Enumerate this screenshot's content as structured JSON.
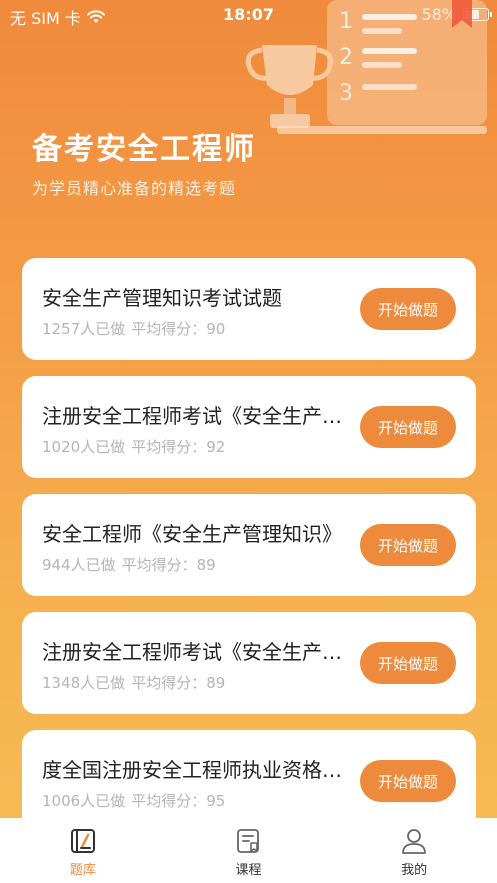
{
  "status_bar": {
    "carrier": "无 SIM 卡",
    "time": "18:07",
    "battery_text": "58%",
    "battery_level": 0.58
  },
  "hero": {
    "title": "备考安全工程师",
    "subtitle": "为学员精心准备的精选考题"
  },
  "exams": [
    {
      "title": "安全生产管理知识考试试题",
      "participants": "1257人已做",
      "avg_score": "平均得分：90",
      "button": "开始做题"
    },
    {
      "title": "注册安全工程师考试《安全生产管理知识》",
      "participants": "1020人已做",
      "avg_score": "平均得分：92",
      "button": "开始做题"
    },
    {
      "title": "安全工程师《安全生产管理知识》",
      "participants": "944人已做",
      "avg_score": "平均得分：89",
      "button": "开始做题"
    },
    {
      "title": "注册安全工程师考试《安全生产技术》",
      "participants": "1348人已做",
      "avg_score": "平均得分：89",
      "button": "开始做题"
    },
    {
      "title": "度全国注册安全工程师执业资格考试",
      "participants": "1006人已做",
      "avg_score": "平均得分：95",
      "button": "开始做题"
    }
  ],
  "tabs": [
    {
      "label": "题库",
      "icon": "question-bank-icon",
      "active": true
    },
    {
      "label": "课程",
      "icon": "course-icon",
      "active": false
    },
    {
      "label": "我的",
      "icon": "profile-icon",
      "active": false
    }
  ],
  "colors": {
    "accent": "#ee8a3b",
    "background_top": "#f08a3c",
    "background_bottom": "#f7bd57"
  }
}
